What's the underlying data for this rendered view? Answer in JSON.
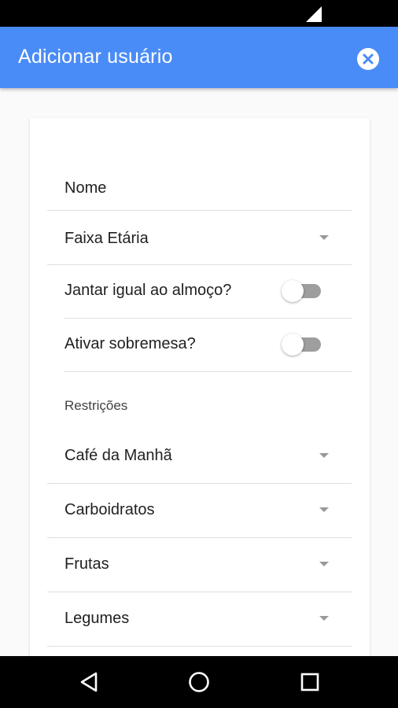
{
  "appbar": {
    "title": "Adicionar usuário",
    "close_icon": "close-circle-icon"
  },
  "form": {
    "name_field": {
      "placeholder": "Nome",
      "value": ""
    },
    "age_select": {
      "label": "Faixa Etária"
    },
    "dinner_toggle": {
      "label": "Jantar igual ao almoço?",
      "checked": false
    },
    "dessert_toggle": {
      "label": "Ativar sobremesa?",
      "checked": false
    },
    "restrictions": {
      "heading": "Restrições",
      "items": [
        {
          "label": "Café da Manhã"
        },
        {
          "label": "Carboidratos"
        },
        {
          "label": "Frutas"
        },
        {
          "label": "Legumes"
        }
      ]
    }
  },
  "nav": {
    "back_icon": "back-triangle-icon",
    "home_icon": "home-circle-icon",
    "recents_icon": "recents-square-icon"
  },
  "colors": {
    "primary": "#4a8cf7",
    "toggle_off": "#9e9e9e"
  }
}
